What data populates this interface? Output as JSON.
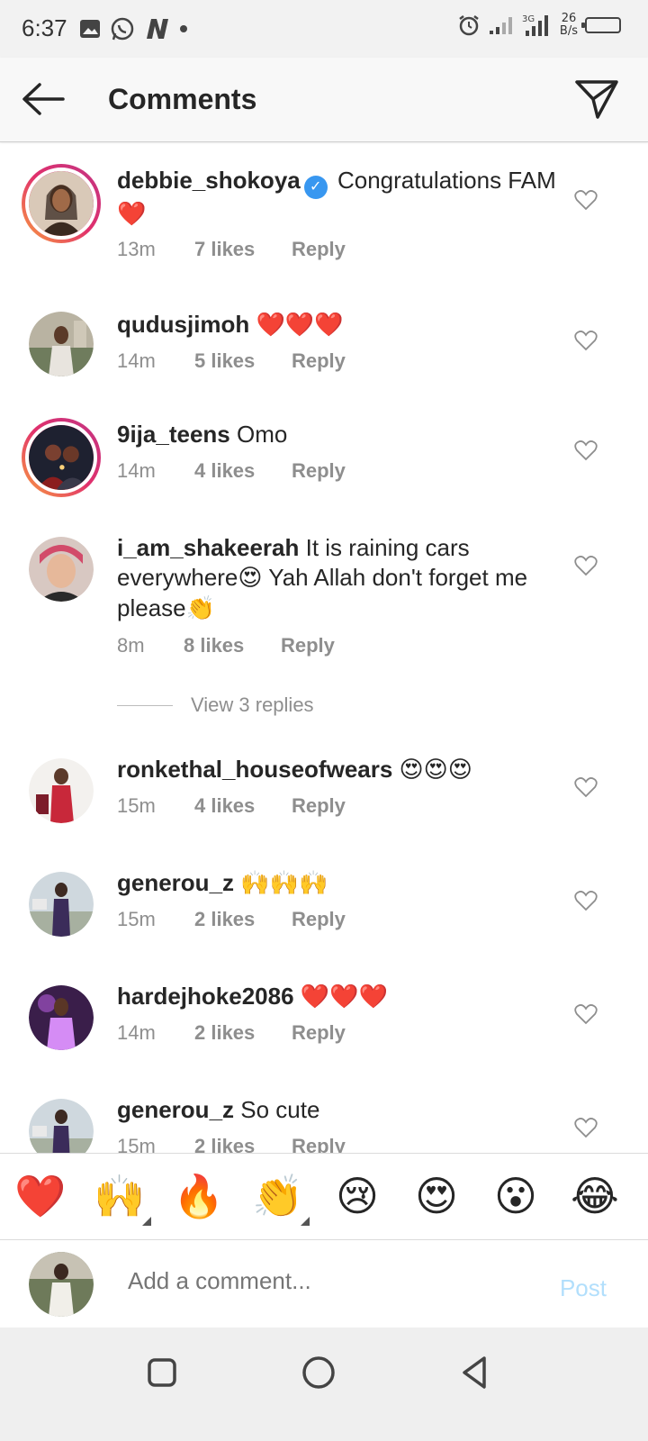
{
  "status_bar": {
    "time": "6:37",
    "speed_value": "26",
    "speed_unit": "B/s",
    "network": "3G"
  },
  "header": {
    "title": "Comments"
  },
  "comments": [
    {
      "user": "debbie_shokoya",
      "verified": true,
      "text": "Congratulations FAM",
      "emoji": "❤️",
      "time": "13m",
      "likes": "7 likes",
      "reply": "Reply"
    },
    {
      "user": "qudusjimoh",
      "text": "",
      "emoji": "❤️❤️❤️",
      "time": "14m",
      "likes": "5 likes",
      "reply": "Reply"
    },
    {
      "user": "9ija_teens",
      "text": "Omo",
      "emoji": "",
      "time": "14m",
      "likes": "4 likes",
      "reply": "Reply"
    },
    {
      "user": "i_am_shakeerah",
      "text": "It is raining cars everywhere",
      "emoji": "😍",
      "text2": "Yah Allah don't forget me please",
      "emoji2": "👏",
      "time": "8m",
      "likes": "8 likes",
      "reply": "Reply"
    },
    {
      "user": "ronkethal_houseofwears",
      "text": "",
      "emoji": "😍😍😍",
      "time": "15m",
      "likes": "4 likes",
      "reply": "Reply"
    },
    {
      "user": "generou_z",
      "text": "",
      "emoji": "🙌🙌🙌",
      "time": "15m",
      "likes": "2 likes",
      "reply": "Reply"
    },
    {
      "user": "hardejhoke2086",
      "text": "",
      "emoji": "❤️❤️❤️",
      "time": "14m",
      "likes": "2 likes",
      "reply": "Reply"
    },
    {
      "user": "generou_z",
      "text": "So cute",
      "emoji": "",
      "time": "15m",
      "likes": "2 likes",
      "reply": "Reply"
    }
  ],
  "view_replies": "View 3 replies",
  "emoji_bar": [
    "❤️",
    "🙌",
    "🔥",
    "👏",
    "😢",
    "😍",
    "😮",
    "😂"
  ],
  "add_comment": {
    "placeholder": "Add a comment...",
    "post_label": "Post"
  },
  "colors": {
    "link_blue_disabled": "#b2dffc",
    "verified_blue": "#3897f0",
    "meta_gray": "#8e8e8e"
  }
}
